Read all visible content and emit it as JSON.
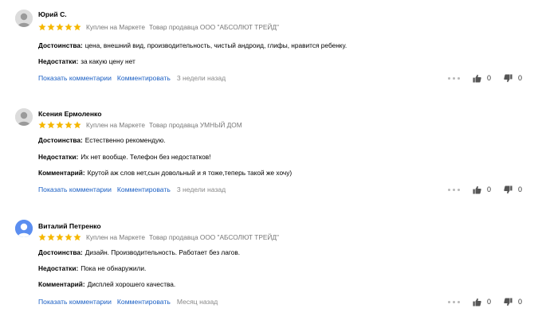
{
  "reviews": [
    {
      "author": "Юрий С.",
      "avatar_type": "gray-user",
      "rating": 5,
      "purchase": "Куплен на Маркете",
      "seller": "Товар продавца ООО \"АБСОЛЮТ ТРЕЙД\"",
      "lines": [
        {
          "label": "Достоинства:",
          "text": "цена, внешний вид, производительность, чистый андроид, глифы, нравится ребенку."
        },
        {
          "label": "Недостатки:",
          "text": "за какую цену нет"
        }
      ],
      "show_comments": "Показать комментарии",
      "comment": "Комментировать",
      "date": "3 недели назад",
      "likes": "0",
      "dislikes": "0"
    },
    {
      "author": "Ксения Ермоленко",
      "avatar_type": "gray-user",
      "rating": 5,
      "purchase": "Куплен на Маркете",
      "seller": "Товар продавца УМНЫЙ ДОМ",
      "lines": [
        {
          "label": "Достоинства:",
          "text": "Естественно рекомендую."
        },
        {
          "label": "Недостатки:",
          "text": "Их нет вообще. Телефон без недостатков!"
        },
        {
          "label": "Комментарий:",
          "text": "Крутой аж слов нет,сын довольный и я тоже,теперь такой же хочу)"
        }
      ],
      "show_comments": "Показать комментарии",
      "comment": "Комментировать",
      "date": "3 недели назад",
      "likes": "0",
      "dislikes": "0"
    },
    {
      "author": "Виталий Петренко",
      "avatar_type": "blue-user",
      "rating": 5,
      "purchase": "Куплен на Маркете",
      "seller": "Товар продавца ООО \"АБСОЛЮТ ТРЕЙД\"",
      "lines": [
        {
          "label": "Достоинства:",
          "text": "Дизайн. Производительность. Работает без лагов."
        },
        {
          "label": "Недостатки:",
          "text": "Пока не обнаружили."
        },
        {
          "label": "Комментарий:",
          "text": "Дисплей хорошего качества."
        }
      ],
      "show_comments": "Показать комментарии",
      "comment": "Комментировать",
      "date": "Месяц назад",
      "likes": "0",
      "dislikes": "0"
    }
  ],
  "colors": {
    "star": "#f5b700",
    "link": "#1a5fc4",
    "muted": "#888888"
  },
  "icons": {
    "star": "star-icon",
    "more": "more-dots-icon",
    "like": "thumb-up-icon",
    "dislike": "thumb-down-icon",
    "avatar": "user-avatar-icon"
  }
}
